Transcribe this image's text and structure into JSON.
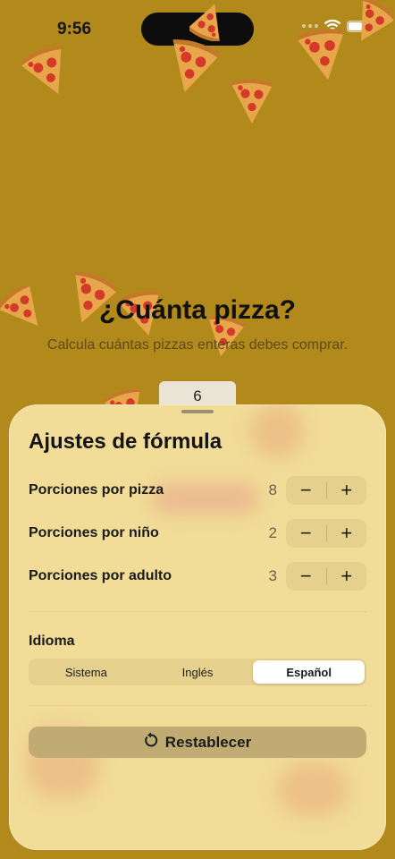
{
  "status_bar": {
    "time": "9:56"
  },
  "header": {
    "title": "¿Cuánta pizza?",
    "subtitle": "Calcula cuántas pizzas enteras debes comprar."
  },
  "count_tab": {
    "value": "6"
  },
  "settings_sheet": {
    "title": "Ajustes de fórmula",
    "rows": [
      {
        "label": "Porciones por pizza",
        "value": "8"
      },
      {
        "label": "Porciones por niño",
        "value": "2"
      },
      {
        "label": "Porciones por adulto",
        "value": "3"
      }
    ],
    "stepper": {
      "decrement": "−",
      "increment": "+"
    },
    "language": {
      "label": "Idioma",
      "options": [
        "Sistema",
        "Inglés",
        "Español"
      ],
      "selected": "Español"
    },
    "reset_label": "Restablecer"
  },
  "colors": {
    "background": "#b28a1c",
    "sheet": "#f1dc98",
    "stepper": "#e6d08d",
    "reset_button": "#c0ac73"
  },
  "icons": [
    "wifi-icon",
    "battery-icon",
    "pizza-slice-icon",
    "reset-arrow-icon"
  ]
}
